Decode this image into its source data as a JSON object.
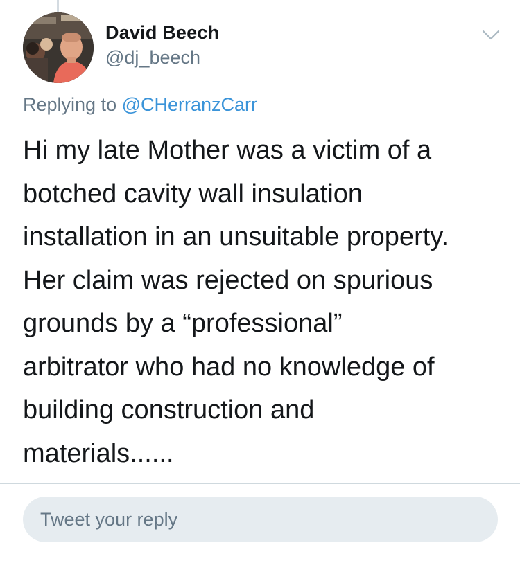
{
  "tweet": {
    "author_name": "David Beech",
    "author_handle": "@dj_beech",
    "replying_prefix": "Replying to",
    "replying_to": "@CHerranzCarr",
    "text_lines": [
      "Hi my late Mother was a victim of a",
      "botched cavity wall insulation",
      "installation in an unsuitable property.",
      "Her claim was rejected on spurious",
      "grounds by a “professional”",
      "arbitrator who had no knowledge of",
      "building construction and",
      "materials......"
    ]
  },
  "reply": {
    "placeholder": "Tweet your reply"
  },
  "icons": {
    "menu": "chevron-down-icon",
    "avatar": "avatar-photo"
  },
  "colors": {
    "text_primary": "#14171a",
    "text_secondary": "#657786",
    "link": "#3b94d9",
    "reply_box_bg": "#e6ecf0",
    "divider": "#cfd9de"
  }
}
